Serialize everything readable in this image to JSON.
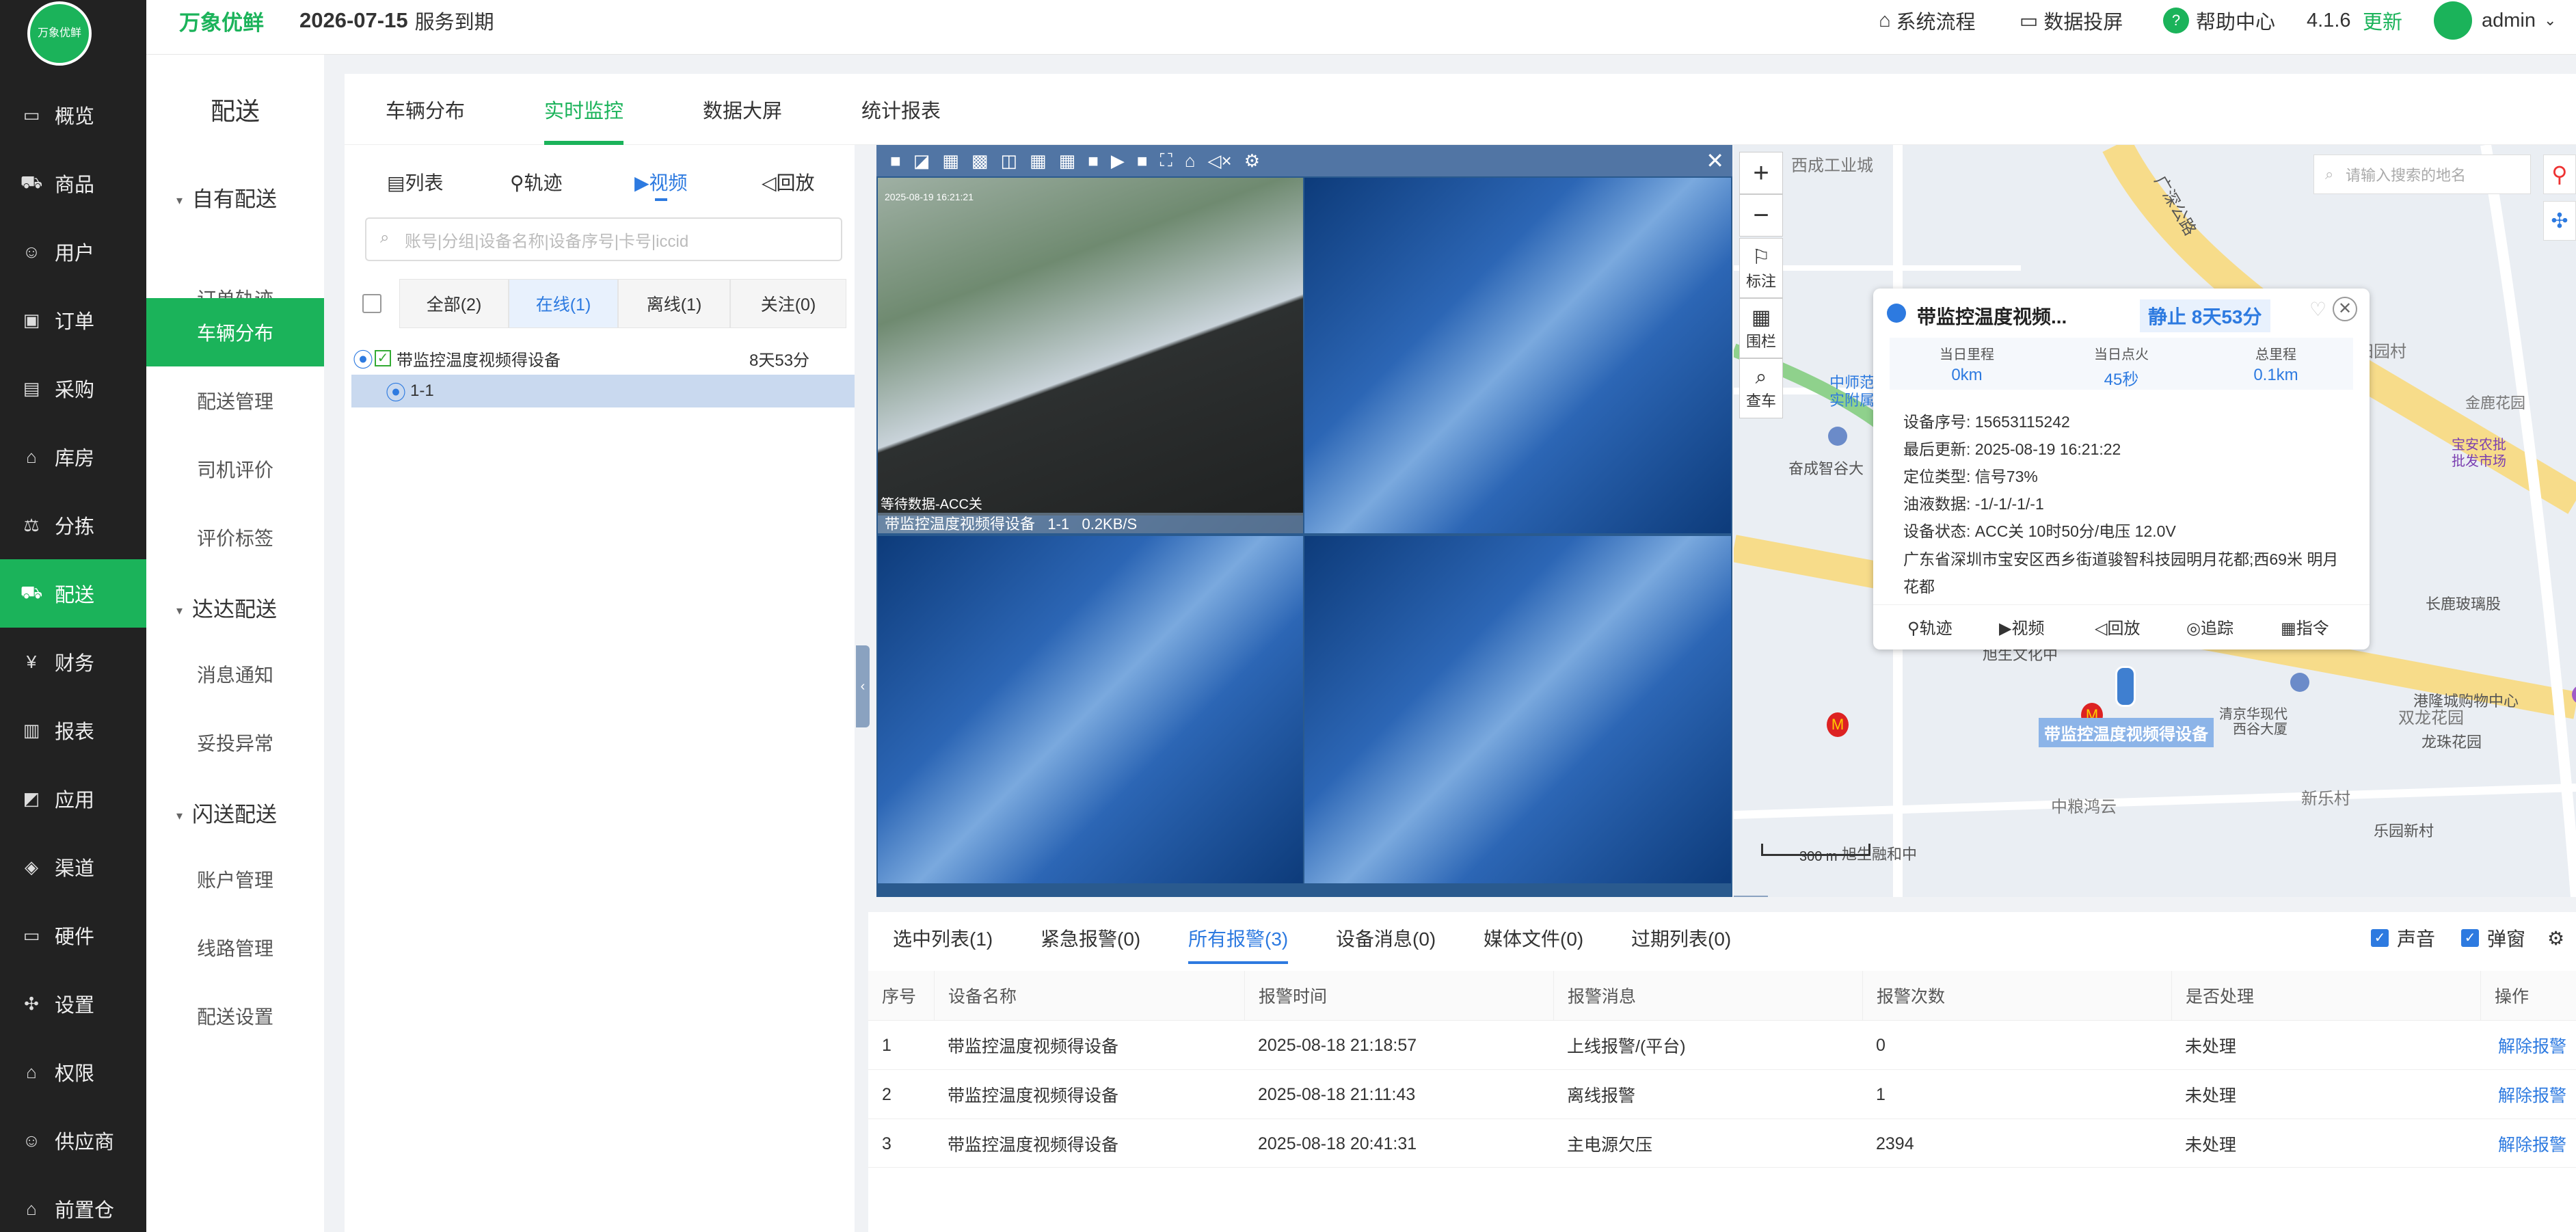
{
  "brand": {
    "name": "万象优鲜",
    "logo_text": "万象优鲜"
  },
  "header": {
    "expire_date": "2026-07-15",
    "expire_suffix": "服务到期",
    "process_label": "系统流程",
    "screen_label": "数据投屏",
    "help_label": "帮助中心",
    "version": "4.1.6",
    "update_label": "更新",
    "user": "admin"
  },
  "sidebar": {
    "items": [
      {
        "label": "概览",
        "icon": "monitor-icon"
      },
      {
        "label": "商品",
        "icon": "cart-icon"
      },
      {
        "label": "用户",
        "icon": "users-icon"
      },
      {
        "label": "订单",
        "icon": "money-icon"
      },
      {
        "label": "采购",
        "icon": "bus-icon"
      },
      {
        "label": "库房",
        "icon": "home-icon"
      },
      {
        "label": "分拣",
        "icon": "scale-icon"
      },
      {
        "label": "配送",
        "icon": "truck-icon"
      },
      {
        "label": "财务",
        "icon": "yen-icon"
      },
      {
        "label": "报表",
        "icon": "chart-icon"
      },
      {
        "label": "应用",
        "icon": "apps-icon"
      },
      {
        "label": "渠道",
        "icon": "box-icon"
      },
      {
        "label": "硬件",
        "icon": "monitor-icon"
      },
      {
        "label": "设置",
        "icon": "puzzle-icon"
      },
      {
        "label": "权限",
        "icon": "bank-icon"
      },
      {
        "label": "供应商",
        "icon": "users-icon"
      },
      {
        "label": "前置仓",
        "icon": "home-icon"
      }
    ]
  },
  "subnav": {
    "title": "配送",
    "groups": [
      "自有配送",
      "达达配送",
      "闪送配送"
    ],
    "items": [
      "订单轨迹",
      "车辆分布",
      "配送管理",
      "司机评价",
      "评价标签",
      "消息通知",
      "妥投异常",
      "账户管理",
      "线路管理",
      "配送设置"
    ]
  },
  "tabs": [
    "车辆分布",
    "实时监控",
    "数据大屏",
    "统计报表"
  ],
  "panel": {
    "view_tabs": [
      "列表",
      "轨迹",
      "视频",
      "回放"
    ],
    "search_placeholder": "账号|分组|设备名称|设备序号|卡号|iccid",
    "filters": [
      "全部(2)",
      "在线(1)",
      "离线(1)",
      "关注(0)"
    ],
    "device_name": "带监控温度视频得设备",
    "device_time": "8天53分",
    "channel": "1-1"
  },
  "video": {
    "label": "带监控温度视频得设备   1-1   0.2KB/S",
    "osd": "等待数据-ACC关",
    "timestamp": "2025-08-19 16:21:21"
  },
  "map": {
    "search_placeholder": "请输入搜索的地名",
    "tools": [
      "标注",
      "围栏",
      "查车"
    ],
    "labels": [
      "西成工业城",
      "广深公路",
      "中师范大学",
      "实附属学校",
      "奋成智谷大",
      "旭生文化中",
      "中粮鸿云",
      "新乐村",
      "乐园新村",
      "旭生融和中",
      "龙珠花园",
      "双龙花园",
      "港隆城购物中心",
      "长鹿玻璃股",
      "宝安农批",
      "批发市场",
      "金鹿花园",
      "田园村",
      "清京华现代",
      "西谷大厦"
    ],
    "car_label": "带监控温度视频得设备",
    "scale": "300 m"
  },
  "popup": {
    "title": "带监控温度视频...",
    "status": "静止 8天53分",
    "stats": [
      {
        "label": "当日里程",
        "value": "0km"
      },
      {
        "label": "当日点火",
        "value": "45秒"
      },
      {
        "label": "总里程",
        "value": "0.1km"
      }
    ],
    "fields": [
      "设备序号: 15653115242",
      "最后更新: 2025-08-19 16:21:22",
      "定位类型: 信号73%",
      "油液数据: -1/-1/-1/-1",
      "设备状态: ACC关 10时50分/电压 12.0V",
      "广东省深圳市宝安区西乡街道骏智科技园明月花都;西69米 明月花都"
    ],
    "actions": [
      "轨迹",
      "视频",
      "回放",
      "追踪",
      "指令"
    ]
  },
  "alarms": {
    "tabs": [
      "选中列表(1)",
      "紧急报警(0)",
      "所有报警(3)",
      "设备消息(0)",
      "媒体文件(0)",
      "过期列表(0)"
    ],
    "sound_label": "声音",
    "popup_label": "弹窗",
    "columns": [
      "序号",
      "设备名称",
      "报警时间",
      "报警消息",
      "报警次数",
      "是否处理",
      "操作"
    ],
    "rows": [
      [
        "1",
        "带监控温度视频得设备",
        "2025-08-18 21:18:57",
        "上线报警/(平台)",
        "0",
        "未处理",
        "解除报警"
      ],
      [
        "2",
        "带监控温度视频得设备",
        "2025-08-18 21:11:43",
        "离线报警",
        "1",
        "未处理",
        "解除报警"
      ],
      [
        "3",
        "带监控温度视频得设备",
        "2025-08-18 20:41:31",
        "主电源欠压",
        "2394",
        "未处理",
        "解除报警"
      ]
    ]
  },
  "colors": {
    "brand_green": "#1bb35a",
    "link_blue": "#2d7ae0",
    "sidebar_bg": "#222222"
  }
}
